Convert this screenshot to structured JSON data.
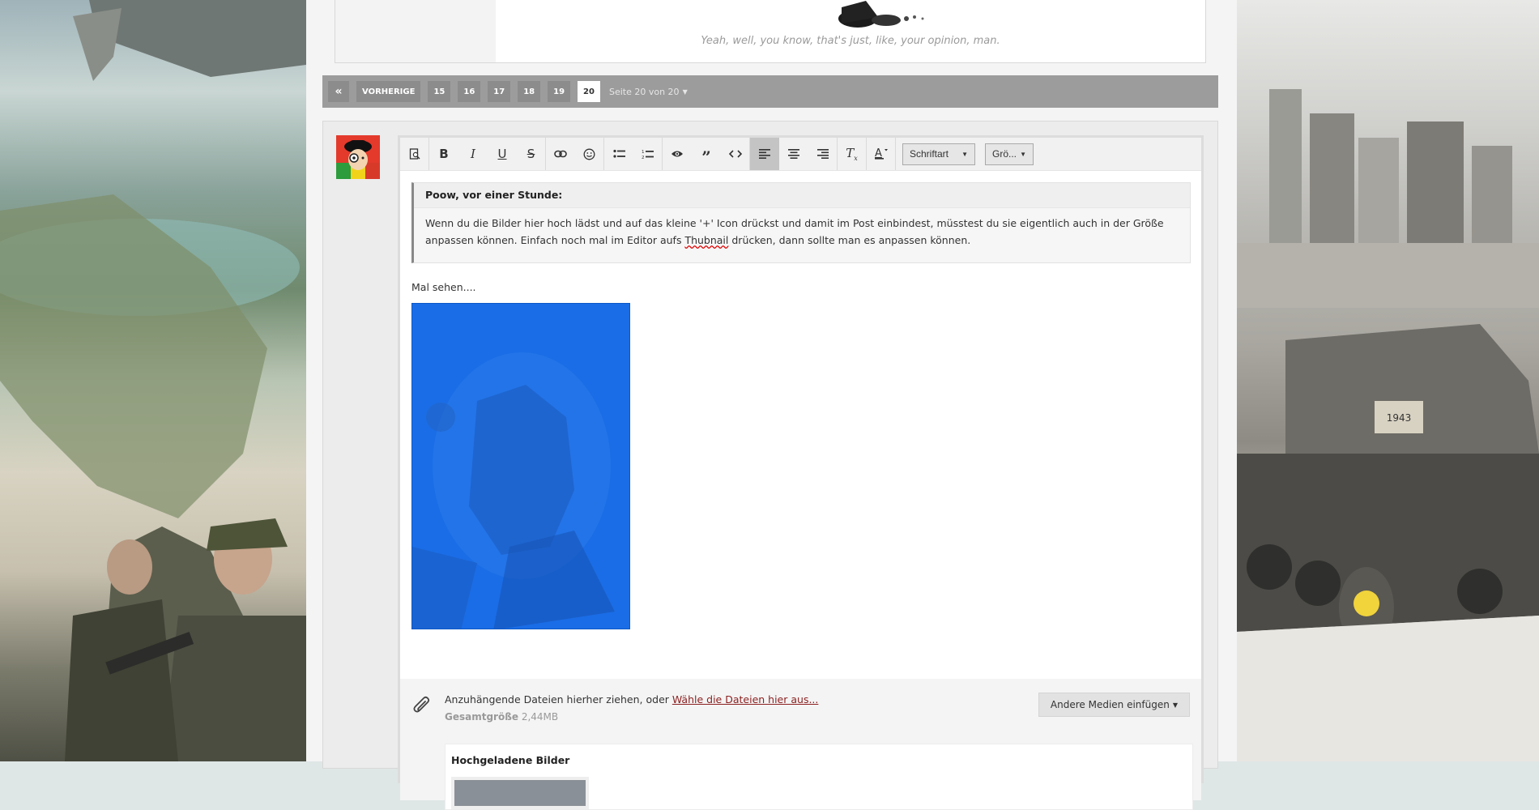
{
  "signature": {
    "quote": "Yeah, well, you know, that's just, like, your opinion, man."
  },
  "pagination": {
    "first_icon": "double-chevron-left-icon",
    "prev_label": "VORHERIGE",
    "pages": [
      "15",
      "16",
      "17",
      "18",
      "19",
      "20"
    ],
    "current_page": "20",
    "info": "Seite 20 von 20"
  },
  "editor": {
    "toolbar": {
      "font_select": "Schriftart",
      "size_select": "Grö..."
    },
    "quote": {
      "header": "Poow, vor einer Stunde:",
      "body_part1": "Wenn du die Bilder hier hoch lädst und auf das kleine '+' Icon drückst und damit im Post einbindest, müsstest du sie eigentlich auch in der Größe anpassen können. Einfach noch mal im Editor aufs ",
      "body_misspelled": "Thubnail",
      "body_part2": " drücken, dann sollte man es anpassen können."
    },
    "paragraph": "Mal sehen...."
  },
  "attachments": {
    "drop_text": "Anzuhängende Dateien hierher ziehen, oder ",
    "choose_link": "Wähle die Dateien hier aus...",
    "total_label": "Gesamtgröße",
    "total_value": "2,44MB",
    "media_button": "Andere Medien einfügen",
    "uploads_title": "Hochgeladene Bilder"
  },
  "colors": {
    "pagination_bg": "#9c9c9c",
    "link_red": "#8b1f1f",
    "image_blue": "#1a6de6"
  }
}
